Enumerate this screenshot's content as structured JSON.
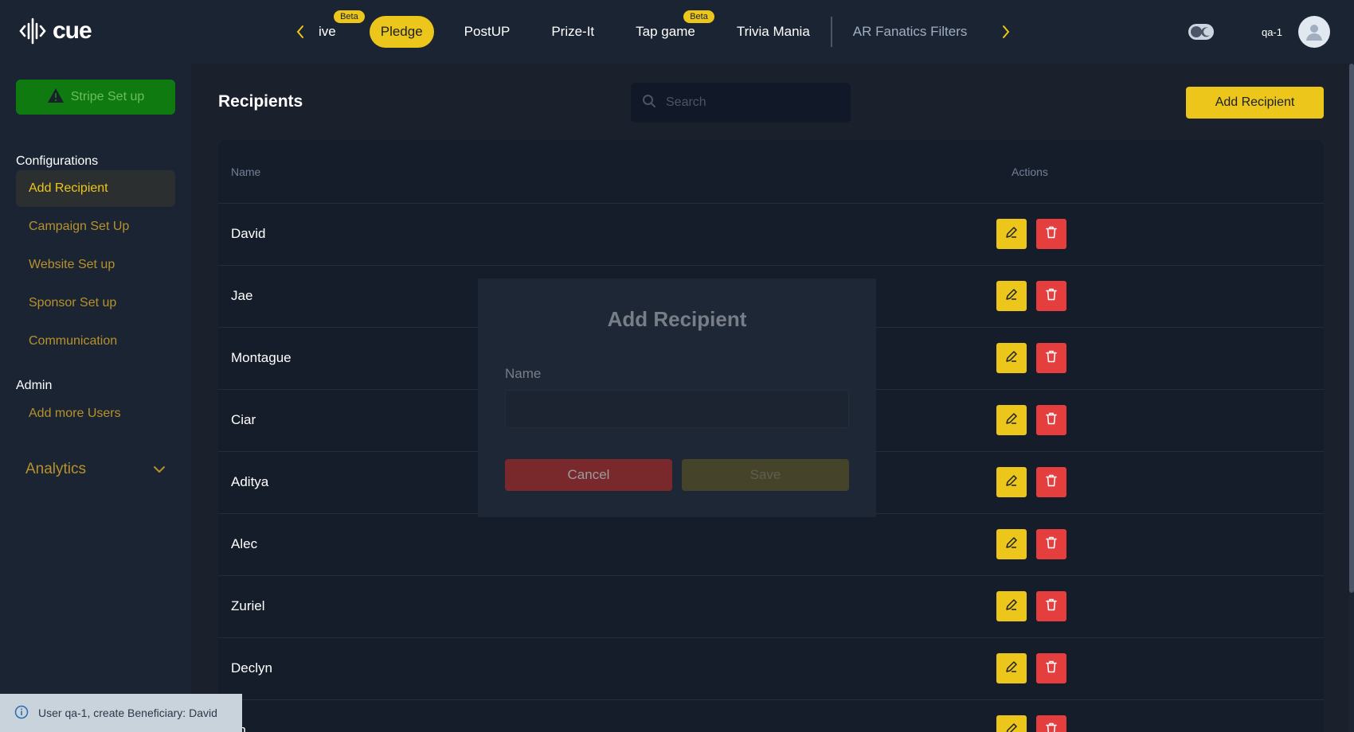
{
  "app": {
    "logo_text": "cue"
  },
  "tabs": {
    "items": [
      {
        "label": "ive",
        "beta": "Beta",
        "state": "normal"
      },
      {
        "label": "Pledge",
        "beta": "",
        "state": "active"
      },
      {
        "label": "PostUP",
        "beta": "",
        "state": "normal"
      },
      {
        "label": "Prize-It",
        "beta": "",
        "state": "normal"
      },
      {
        "label": "Tap game",
        "beta": "Beta",
        "state": "normal"
      },
      {
        "label": "Trivia Mania",
        "beta": "",
        "state": "normal"
      },
      {
        "label": "AR Fanatics Filters",
        "beta": "",
        "state": "dim"
      }
    ]
  },
  "user": {
    "name": "qa-1"
  },
  "sidebar": {
    "stripe_label": "Stripe Set up",
    "configurations_heading": "Configurations",
    "config_items": [
      "Add Recipient",
      "Campaign Set Up",
      "Website Set up",
      "Sponsor Set up",
      "Communication"
    ],
    "admin_heading": "Admin",
    "admin_items": [
      "Add more Users"
    ],
    "analytics_label": "Analytics"
  },
  "main": {
    "title": "Recipients",
    "search_placeholder": "Search",
    "add_button": "Add Recipient",
    "columns": {
      "name": "Name",
      "actions": "Actions"
    },
    "rows": [
      "David",
      "Jae",
      "Montague",
      "Ciar",
      "Aditya",
      "Alec",
      "Zuriel",
      "Declyn",
      "an"
    ]
  },
  "modal": {
    "title": "Add Recipient",
    "name_label": "Name",
    "cancel": "Cancel",
    "save": "Save"
  },
  "toast": {
    "message": "User qa-1, create Beneficiary: David"
  },
  "colors": {
    "accent": "#ecc61a",
    "danger": "#e53e3e",
    "success": "#0f7a0f",
    "background": "#1a202c",
    "panel": "#1b2433"
  }
}
